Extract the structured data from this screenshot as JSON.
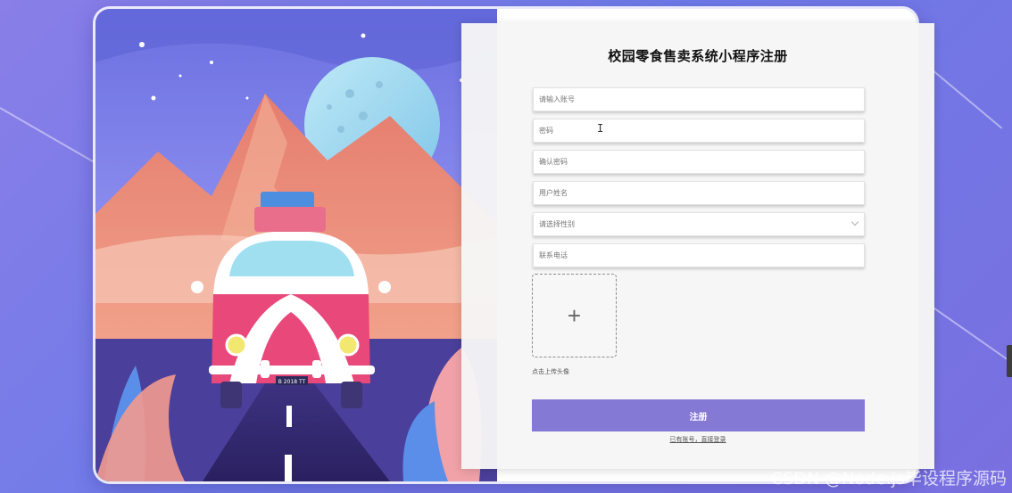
{
  "form": {
    "title": "校园零食售卖系统小程序注册",
    "fields": [
      {
        "placeholder": "请输入账号",
        "value": ""
      },
      {
        "placeholder": "密码",
        "value": ""
      },
      {
        "placeholder": "确认密码",
        "value": ""
      },
      {
        "placeholder": "用户姓名",
        "value": ""
      }
    ],
    "gender_select": {
      "placeholder": "请选择性别",
      "selected": ""
    },
    "phone": {
      "placeholder": "联系电话",
      "value": ""
    },
    "upload": {
      "label": "点击上传头像",
      "icon": "plus-icon",
      "glyph": "+"
    },
    "submit_label": "注册",
    "login_link": "已有账号，直接登录"
  },
  "illustration": {
    "subject": "van-on-road-illustration",
    "license_plate": "B 2018 TT"
  },
  "watermark": "CSDN @Node.js毕设程序源码",
  "colors": {
    "accent": "#8479d4",
    "background": "#7a74e4",
    "panel": "#f6f6f6"
  }
}
